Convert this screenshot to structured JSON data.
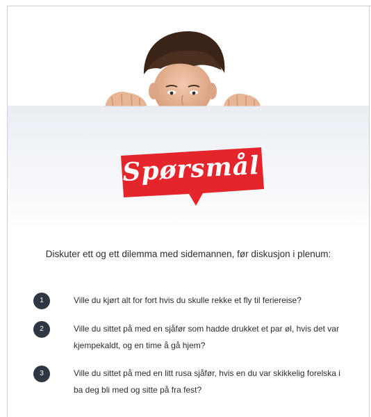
{
  "title": "Spørsmål",
  "instruction": "Diskuter ett og ett dilemma med sidemannen, før diskusjon i plenum:",
  "questions": [
    {
      "number": "1",
      "text": "Ville du kjørt alt for fort hvis du skulle rekke et fly til feriereise?"
    },
    {
      "number": "2",
      "text": "Ville du sittet på med en sjåfør som hadde drukket et par øl, hvis det var kjempekaldt, og en time å gå hjem?"
    },
    {
      "number": "3",
      "text": "Ville du sittet på med en litt rusa sjåfør, hvis en du var skikkelig forelska i ba deg bli med og sitte på fra fest?"
    }
  ],
  "colors": {
    "badge": "#e4262c",
    "number_circle": "#2f3742",
    "text": "#2b2b2b"
  }
}
